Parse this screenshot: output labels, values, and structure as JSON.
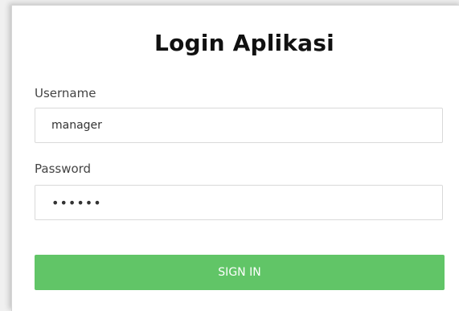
{
  "login": {
    "title": "Login Aplikasi",
    "username_label": "Username",
    "username_value": "manager",
    "password_label": "Password",
    "password_value": "••••••",
    "signin_label": "SIGN IN"
  },
  "colors": {
    "signin_button": "#61c567",
    "background": "#ffffff"
  }
}
